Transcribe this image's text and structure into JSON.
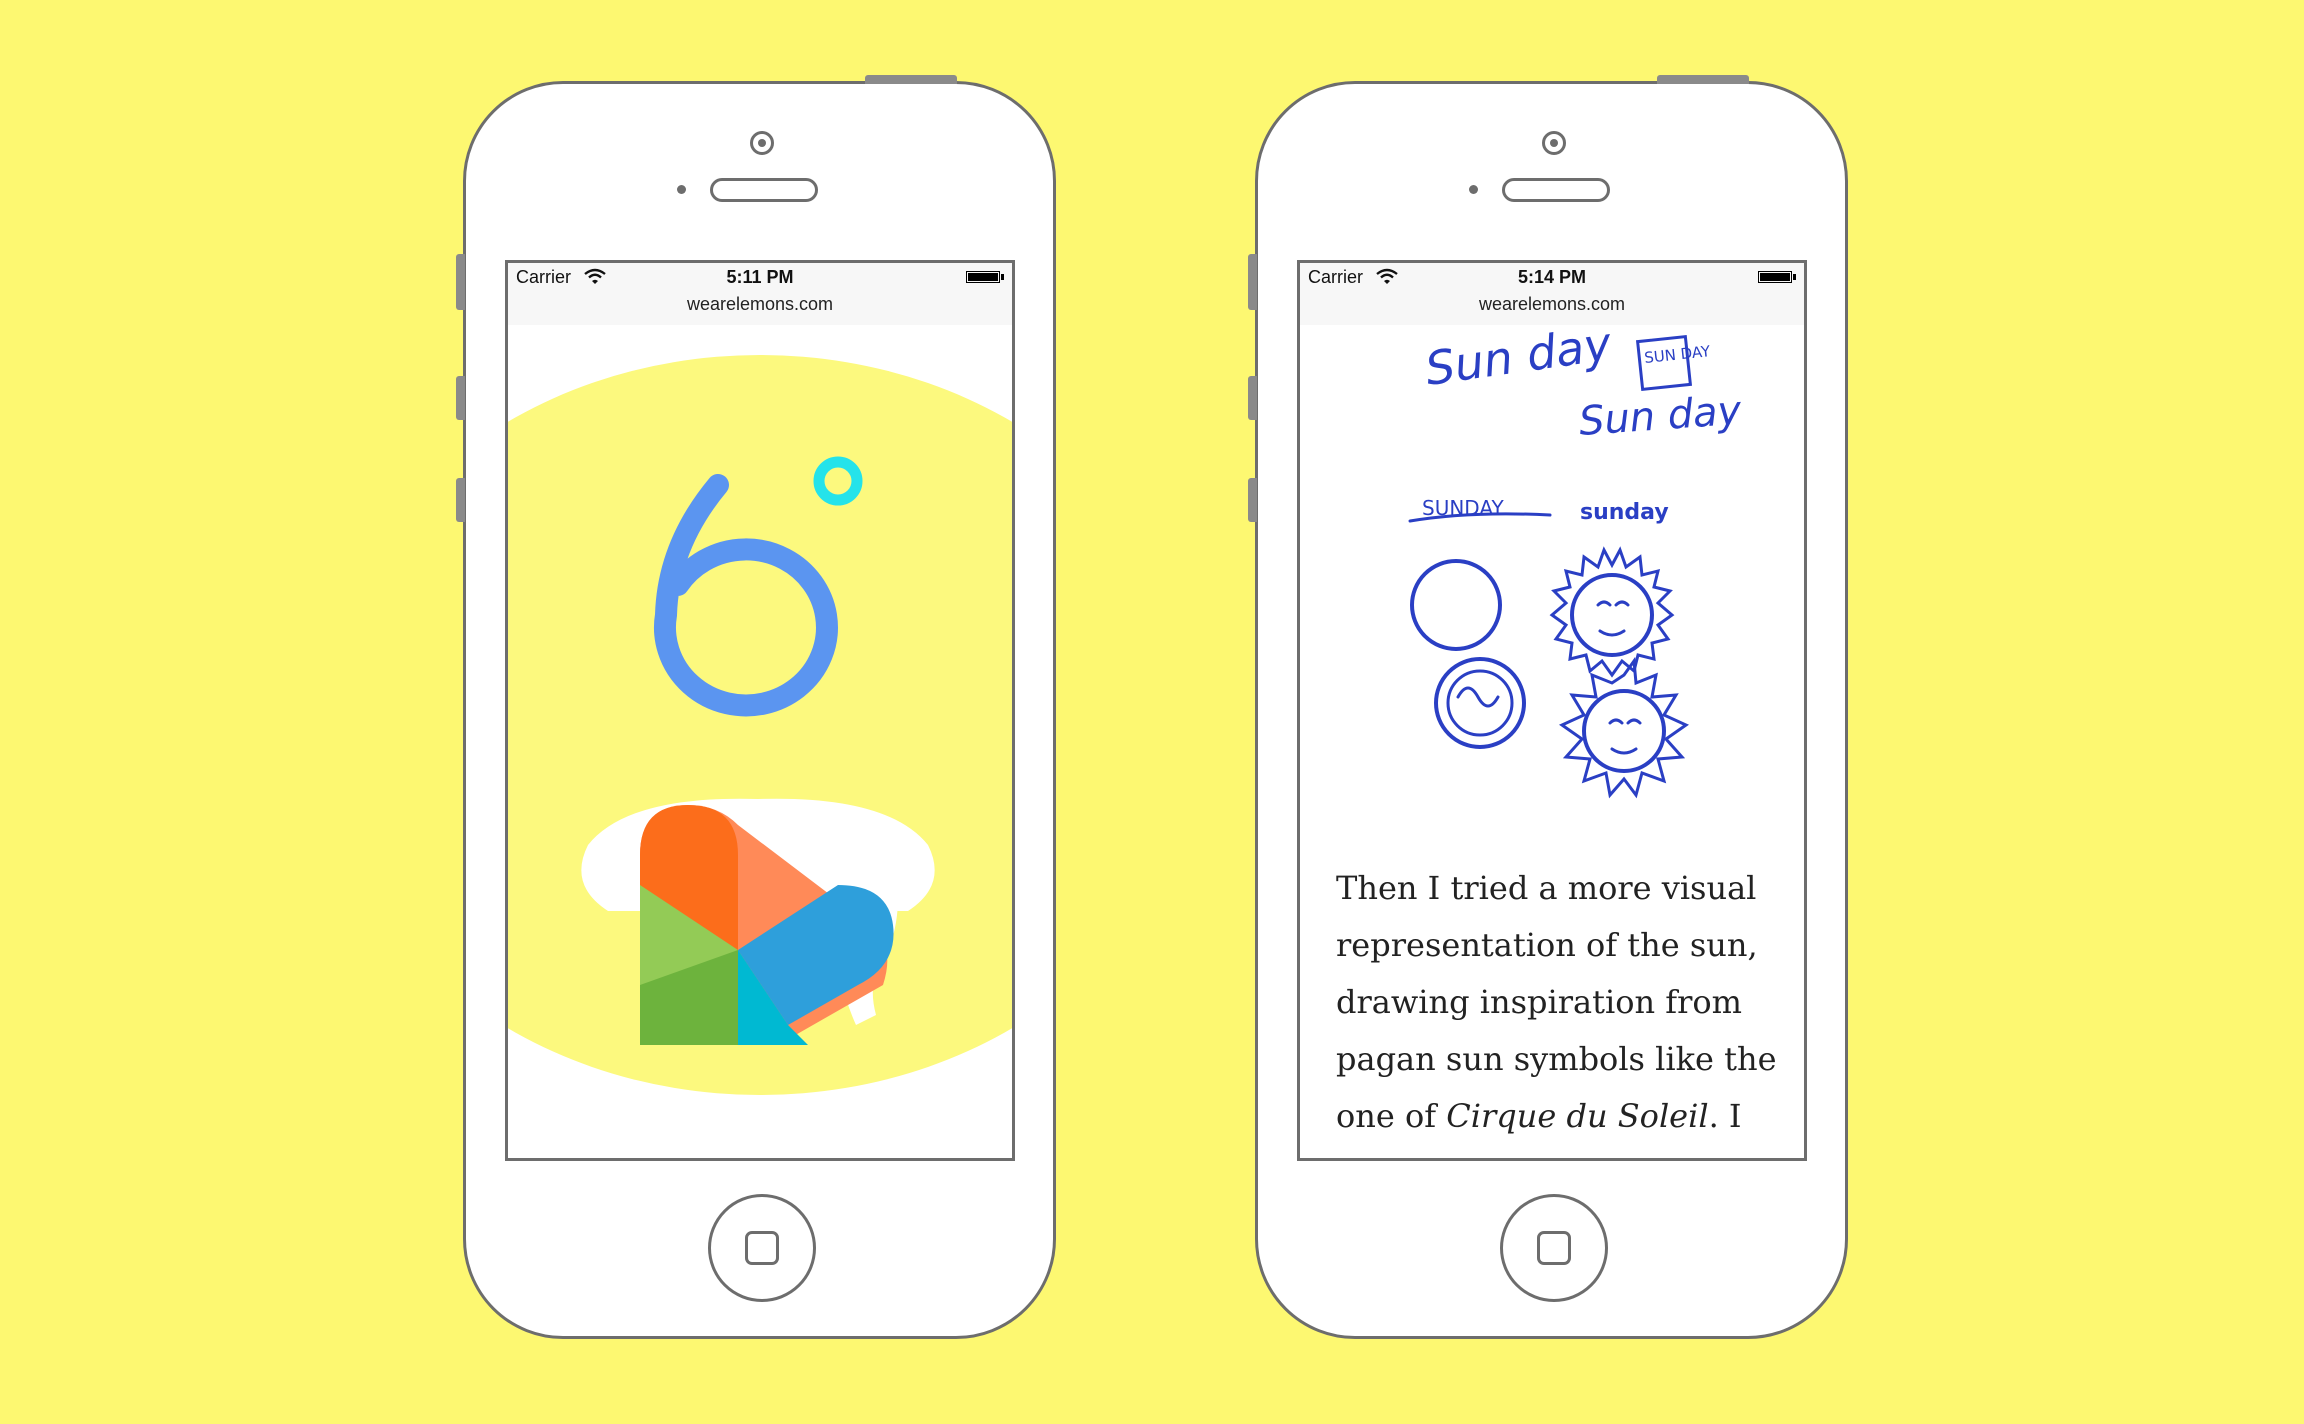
{
  "colors": {
    "background": "#fdf871",
    "phone_outline": "#6d6d6d",
    "sun_yellow": "#fcf97e",
    "digit_blue": "#5b95f0",
    "degree_cyan": "#25e3ea",
    "ink_blue": "#2a3fc4"
  },
  "phones": [
    {
      "carrier": "Carrier",
      "time": "5:11 PM",
      "url": "wearelemons.com",
      "temperature_digit": "6"
    },
    {
      "carrier": "Carrier",
      "time": "5:14 PM",
      "url": "wearelemons.com",
      "sketch_words": [
        "Sun day",
        "Sun day",
        "SUN DAY",
        "SUNDAY",
        "sunday"
      ],
      "article": {
        "text_before": "Then I tried a more visual representation of the sun, drawing inspiration from pagan sun symbols like the one of ",
        "emphasis": "Cirque du Soleil",
        "text_after": ". I"
      }
    }
  ],
  "icons": {
    "wifi": "wifi-icon",
    "battery": "battery-icon",
    "camera": "front-camera-icon",
    "home": "home-button-icon"
  }
}
